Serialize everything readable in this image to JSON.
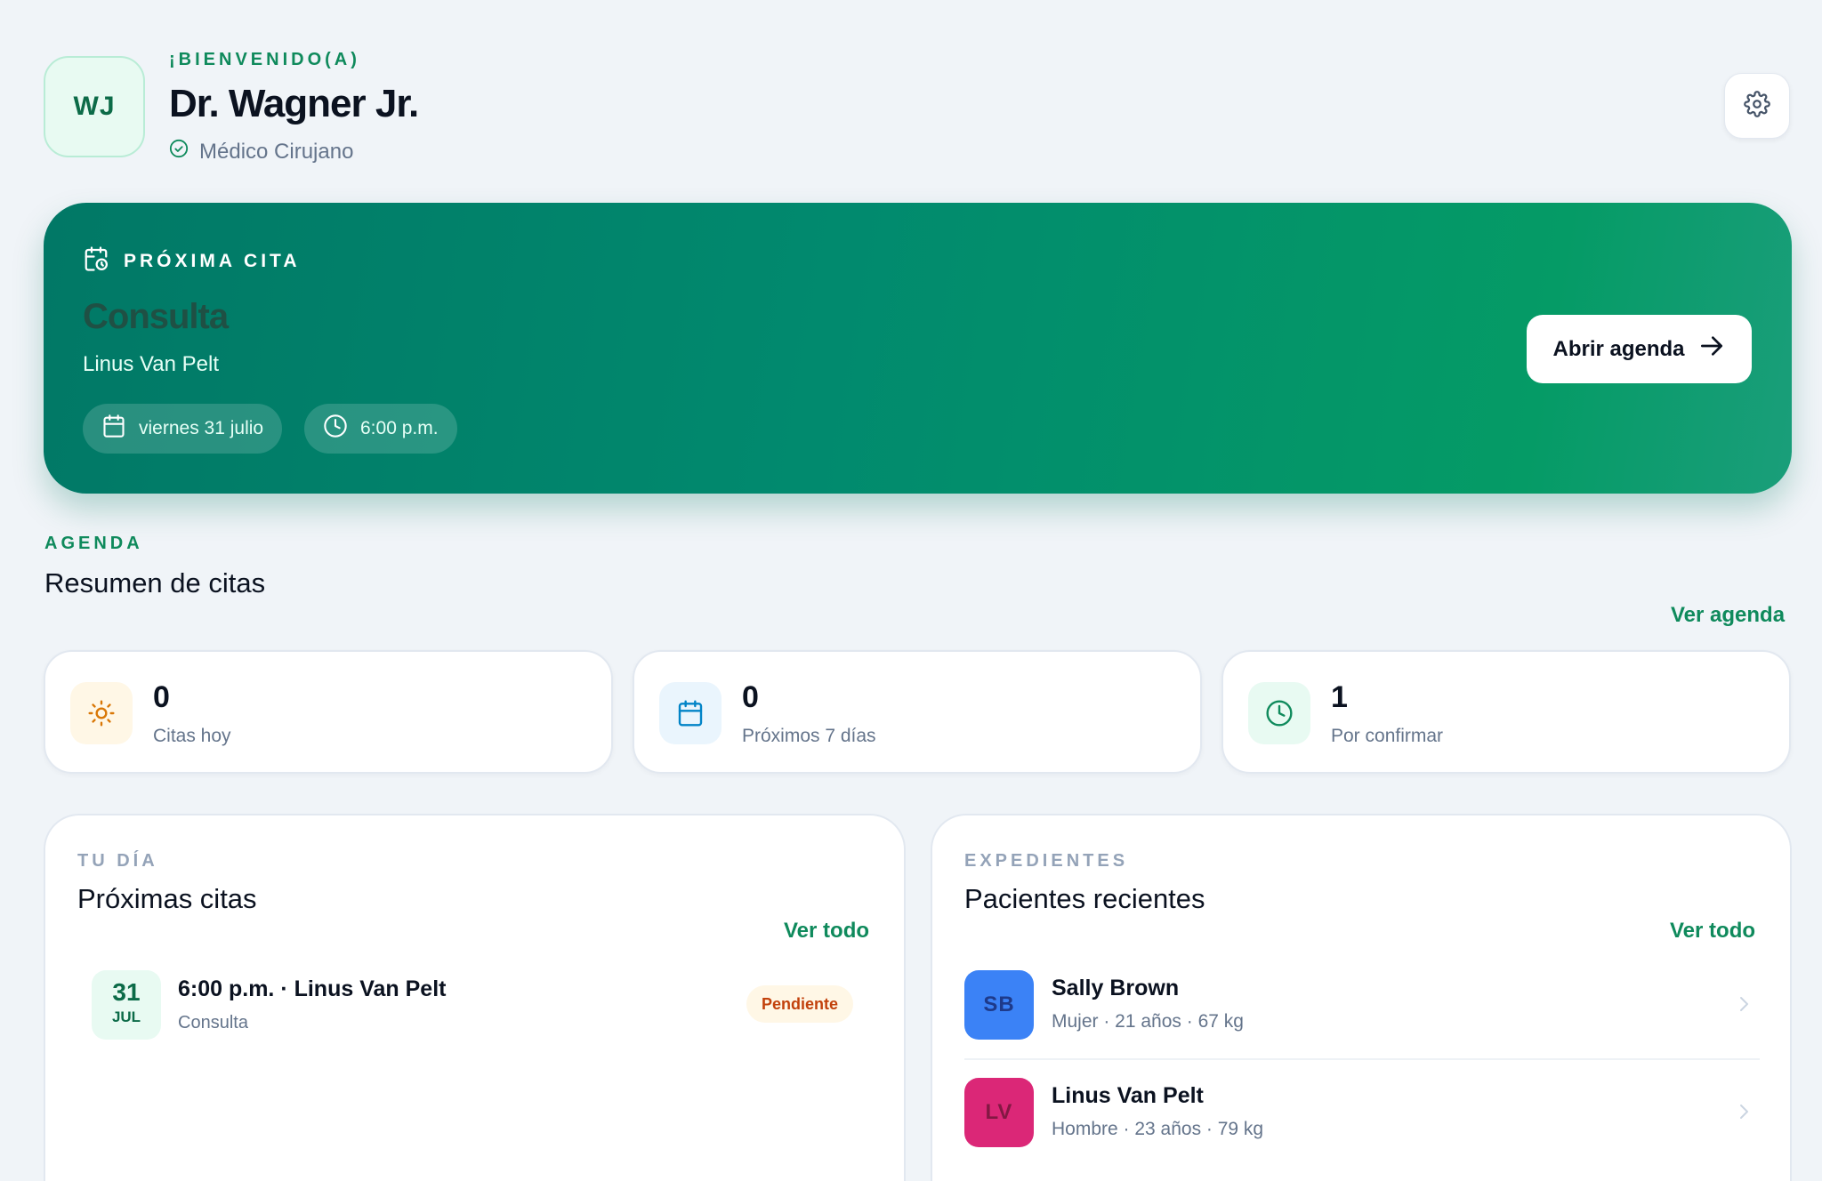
{
  "header": {
    "avatar_initials": "WJ",
    "welcome": "¡BIENVENIDO(A)",
    "doctor_name": "Dr. Wagner Jr.",
    "role": "Médico Cirujano"
  },
  "next_appointment": {
    "label": "PRÓXIMA CITA",
    "type": "Consulta",
    "patient": "Linus Van Pelt",
    "date": "viernes 31 julio",
    "time": "6:00 p.m.",
    "open_button": "Abrir agenda"
  },
  "agenda": {
    "section_label": "AGENDA",
    "title": "Resumen de citas",
    "link": "Ver agenda",
    "stats": [
      {
        "value": "0",
        "label": "Citas hoy",
        "icon": "sun-icon",
        "color": "#d97706",
        "bg": "#fff7e6"
      },
      {
        "value": "0",
        "label": "Próximos 7 días",
        "icon": "calendar-icon",
        "color": "#0284c7",
        "bg": "#eaf5fd"
      },
      {
        "value": "1",
        "label": "Por confirmar",
        "icon": "clock-icon",
        "color": "#0f8a5c",
        "bg": "#e8faf2"
      }
    ]
  },
  "day_panel": {
    "section_label": "TU DÍA",
    "title": "Próximas citas",
    "link": "Ver todo",
    "appointments": [
      {
        "day": "31",
        "month": "JUL",
        "main": "6:00 p.m. · Linus Van Pelt",
        "type": "Consulta",
        "status": "Pendiente"
      }
    ]
  },
  "records_panel": {
    "section_label": "EXPEDIENTES",
    "title": "Pacientes recientes",
    "link": "Ver todo",
    "patients": [
      {
        "initials": "SB",
        "name": "Sally Brown",
        "meta": "Mujer · 21 años · 67 kg",
        "color": "#3b82f6",
        "text_color": "#1e3a8a"
      },
      {
        "initials": "LV",
        "name": "Linus Van Pelt",
        "meta": "Hombre · 23 años · 79 kg",
        "color": "#db2777",
        "text_color": "#831843"
      }
    ]
  },
  "colors": {
    "accent": "#0f8a5c",
    "hero_start": "#017866",
    "hero_end": "#059b66",
    "background": "#f0f4f8"
  }
}
